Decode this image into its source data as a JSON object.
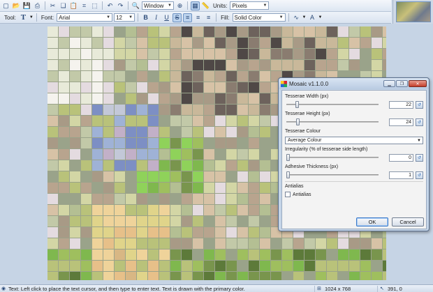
{
  "toolbar_top": {
    "icons": [
      "new-icon",
      "open-icon",
      "save-icon",
      "print-icon",
      "cut-icon",
      "copy-icon",
      "paste-icon",
      "crop-icon",
      "deselect-icon",
      "undo-icon",
      "redo-icon",
      "zoom-icon",
      "grid-icon",
      "ruler-icon"
    ],
    "zoom_value": "Window",
    "units_label": "Units:",
    "units_value": "Pixels"
  },
  "toolbar_text": {
    "tool_label": "Tool:",
    "tool_icon": "text-tool-icon",
    "font_label": "Font:",
    "font_value": "Arial",
    "size_value": "12",
    "bold": "B",
    "italic": "I",
    "underline": "U",
    "strike": "S",
    "fill_label": "Fill:",
    "fill_value": "Solid Color"
  },
  "mosaic_colors": [
    "#9aa38a",
    "#c2c9a8",
    "#e8ead9",
    "#d3d6a5",
    "#b9c27a",
    "#9fbf5e",
    "#7fb84e",
    "#8fd25a",
    "#e0d48a",
    "#efd39a",
    "#c9b89a",
    "#a89a86",
    "#8a7c70",
    "#6d625c",
    "#4f4846",
    "#b8a48e",
    "#d7c2a6",
    "#c3c8d8",
    "#9fb2d6",
    "#7d8fc4",
    "#c2b0c8",
    "#e4dbe0",
    "#f5f3ee",
    "#b4bf93",
    "#79954d",
    "#5d7a3a",
    "#d8b784",
    "#e7c089"
  ],
  "dialog": {
    "title": "Mosaic v1.1.0.0",
    "ctrl_min": "▁",
    "ctrl_restore": "❐",
    "ctrl_close": "✕",
    "tesserae_width_label": "Tesserae Width (px)",
    "tesserae_width_value": "22",
    "tesserae_width_fraction": 0.1,
    "tesserae_height_label": "Tesserae Height (px)",
    "tesserae_height_value": "24",
    "tesserae_height_fraction": 0.11,
    "colour_label": "Tesserae Colour",
    "colour_value": "Average Colour",
    "irregularity_label": "Irregularity (% of tesserae side length)",
    "irregularity_value": "0",
    "irregularity_fraction": 0.0,
    "adhesive_label": "Adhesive Thickness (px)",
    "adhesive_value": "1",
    "adhesive_fraction": 0.0,
    "antialias_group_label": "Antialias",
    "antialias_checkbox_label": "Antialias",
    "ok_label": "OK",
    "cancel_label": "Cancel"
  },
  "status": {
    "message": "Text: Left click to place the text cursor, and then type to enter text. Text is drawn with the primary color.",
    "image_size": "1024 x 768",
    "cursor_pos": "391, 0"
  }
}
